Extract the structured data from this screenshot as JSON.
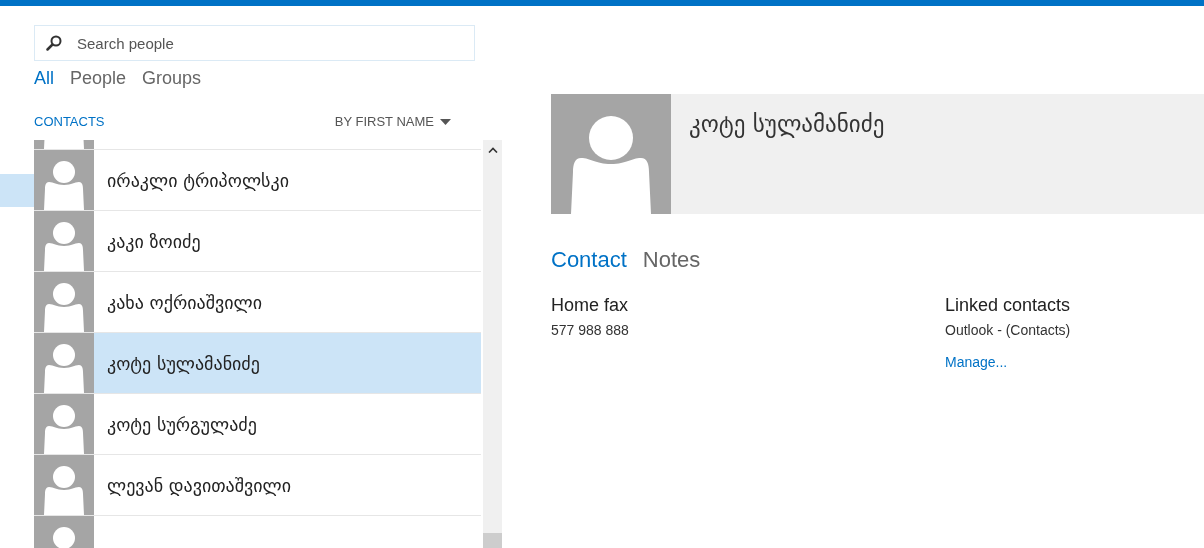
{
  "search": {
    "placeholder": "Search people"
  },
  "filters": [
    {
      "label": "All",
      "selected": true
    },
    {
      "label": "People",
      "selected": false
    },
    {
      "label": "Groups",
      "selected": false
    }
  ],
  "list_header": {
    "title": "CONTACTS",
    "sort": "BY FIRST NAME"
  },
  "contacts": [
    {
      "kind": "partial",
      "selected": false
    },
    {
      "kind": "contact",
      "name": "ირაკლი ტრიპოლსკი",
      "selected": false
    },
    {
      "kind": "contact",
      "name": "კაკი ზოიძე",
      "selected": false
    },
    {
      "kind": "contact",
      "name": "კახა ოქრიაშვილი",
      "selected": false
    },
    {
      "kind": "contact",
      "name": "კოტე სულამანიძე",
      "selected": true
    },
    {
      "kind": "contact",
      "name": "კოტე სურგულაძე",
      "selected": false
    },
    {
      "kind": "contact",
      "name": "ლევან დავითაშვილი",
      "selected": false
    },
    {
      "kind": "partial",
      "selected": false
    }
  ],
  "detail": {
    "name": "კოტე სულამანიძე",
    "tabs": [
      {
        "label": "Contact",
        "selected": true
      },
      {
        "label": "Notes",
        "selected": false
      }
    ],
    "fields": [
      {
        "label": "Home fax",
        "value": "577 988 888"
      }
    ],
    "linked": {
      "label": "Linked contacts",
      "source": "Outlook - (Contacts)",
      "link": "Manage..."
    }
  }
}
